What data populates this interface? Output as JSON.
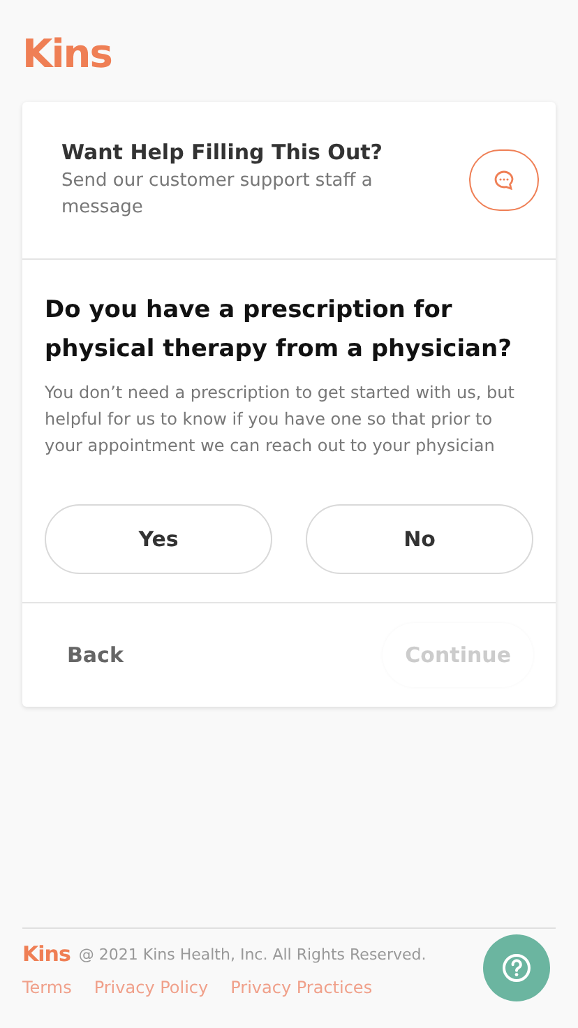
{
  "logo": "Kins",
  "help": {
    "title": "Want Help Filling This Out?",
    "text": "Send our customer support staff a message"
  },
  "question": {
    "title": "Do you have a prescription for physical therapy from a physician?",
    "text": "You don’t need a prescription to get started with us, but helpful for us to know if you have one so that prior to your appointment we can reach out to your physician",
    "options": [
      {
        "label": "Yes",
        "selected": false
      },
      {
        "label": "No",
        "selected": false
      }
    ]
  },
  "nav": {
    "back": "Back",
    "continue": {
      "label": "Continue",
      "disabled": true
    }
  },
  "footer": {
    "logo": "Kins",
    "copyright": "@ 2021 Kins Health, Inc. All Rights Reserved.",
    "links": [
      "Terms",
      "Privacy Policy",
      "Privacy Practices"
    ]
  }
}
